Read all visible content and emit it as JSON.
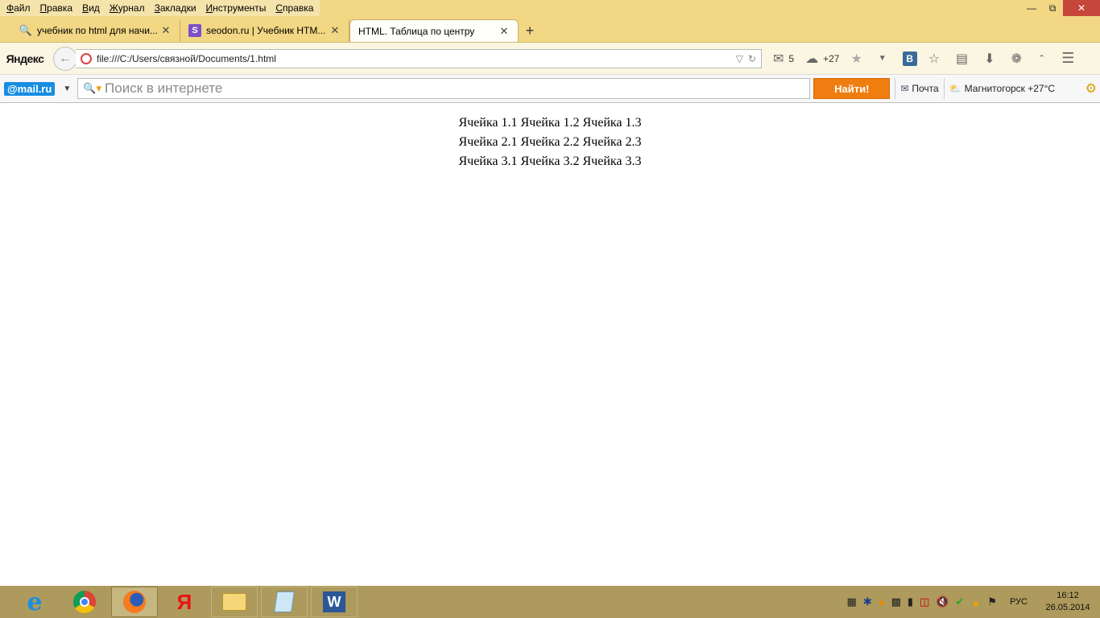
{
  "menu": [
    "Файл",
    "Правка",
    "Вид",
    "Журнал",
    "Закладки",
    "Инструменты",
    "Справка"
  ],
  "tabs": [
    {
      "title": "учебник по html для начи...",
      "icon": "search-key-icon"
    },
    {
      "title": "seodon.ru | Учебник HTM...",
      "icon": "seodon-icon"
    },
    {
      "title": "HTML. Таблица по центру",
      "icon": "none"
    }
  ],
  "nav": {
    "brand": "Яндекс",
    "url": "file:///C:/Users/связной/Documents/1.html",
    "mail_count": "5",
    "weather": "+27"
  },
  "mailru": {
    "logo": "@mail.ru",
    "search_placeholder": "Поиск в интернете",
    "find_button": "Найти!",
    "mail_link": "Почта",
    "weather_link": "Магнитогорск +27°C"
  },
  "table": [
    [
      "Ячейка 1.1",
      "Ячейка 1.2",
      "Ячейка 1.3"
    ],
    [
      "Ячейка 2.1",
      "Ячейка 2.2",
      "Ячейка 2.3"
    ],
    [
      "Ячейка 3.1",
      "Ячейка 3.2",
      "Ячейка 3.3"
    ]
  ],
  "taskbar": {
    "apps": [
      "internet-explorer",
      "chrome",
      "firefox",
      "yandex-browser",
      "file-explorer",
      "notepad",
      "word"
    ],
    "lang": "РУС",
    "time": "16:12",
    "date": "26.05.2014"
  }
}
